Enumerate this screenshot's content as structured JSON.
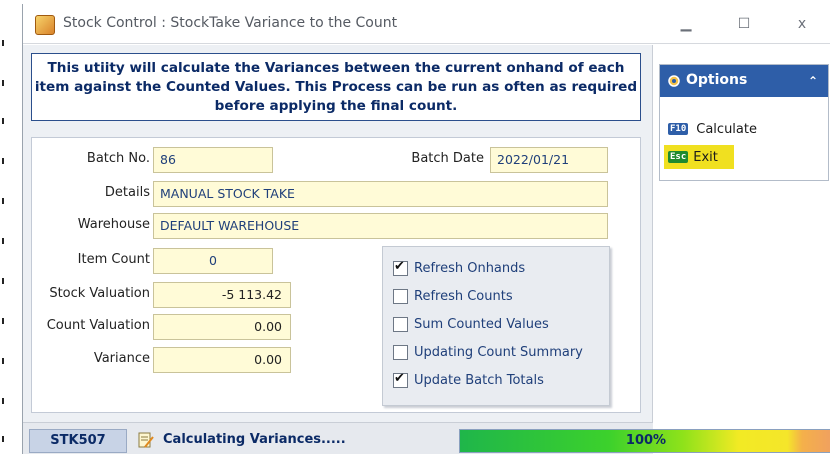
{
  "window": {
    "title": "Stock Control : StockTake Variance to the Count",
    "minimize_icon": "minimize-icon",
    "maximize_icon": "maximize-icon",
    "close_icon": "close-icon",
    "minimize_glyph": "▁",
    "maximize_glyph": "☐",
    "close_glyph": "x"
  },
  "banner": {
    "text": "This utiity will calculate the Variances between the current onhand of each item against the Counted Values. This Process can be run as often as required before applying the final count."
  },
  "form": {
    "batch_no_label": "Batch No.",
    "batch_no": "86",
    "batch_date_label": "Batch Date",
    "batch_date": "2022/01/21",
    "details_label": "Details",
    "details": "MANUAL STOCK TAKE",
    "warehouse_label": "Warehouse",
    "warehouse": "DEFAULT WAREHOUSE",
    "item_count_label": "Item Count",
    "item_count": "0",
    "stock_valuation_label": "Stock Valuation",
    "stock_valuation": "-5 113.42",
    "count_valuation_label": "Count Valuation",
    "count_valuation": "0.00",
    "variance_label": "Variance",
    "variance": "0.00"
  },
  "options_checks": [
    {
      "label": "Refresh Onhands",
      "checked": true
    },
    {
      "label": "Refresh Counts",
      "checked": false
    },
    {
      "label": "Sum Counted Values",
      "checked": false
    },
    {
      "label": "Updating Count Summary",
      "checked": false
    },
    {
      "label": "Update Batch Totals",
      "checked": true
    }
  ],
  "options_panel": {
    "title": "Options",
    "collapse_glyph": "⌃",
    "items": [
      {
        "key": "F10",
        "label": "Calculate"
      },
      {
        "key": "Esc",
        "label": "Exit"
      }
    ]
  },
  "status": {
    "code": "STK507",
    "message": "Calculating Variances.....",
    "progress_text": "100%",
    "progress_value": 1.0
  },
  "colors": {
    "banner_text": "#0b2a66",
    "options_header": "#2e5ea8",
    "exit_highlight": "#f0e020",
    "field_bg": "#fffbd7"
  }
}
